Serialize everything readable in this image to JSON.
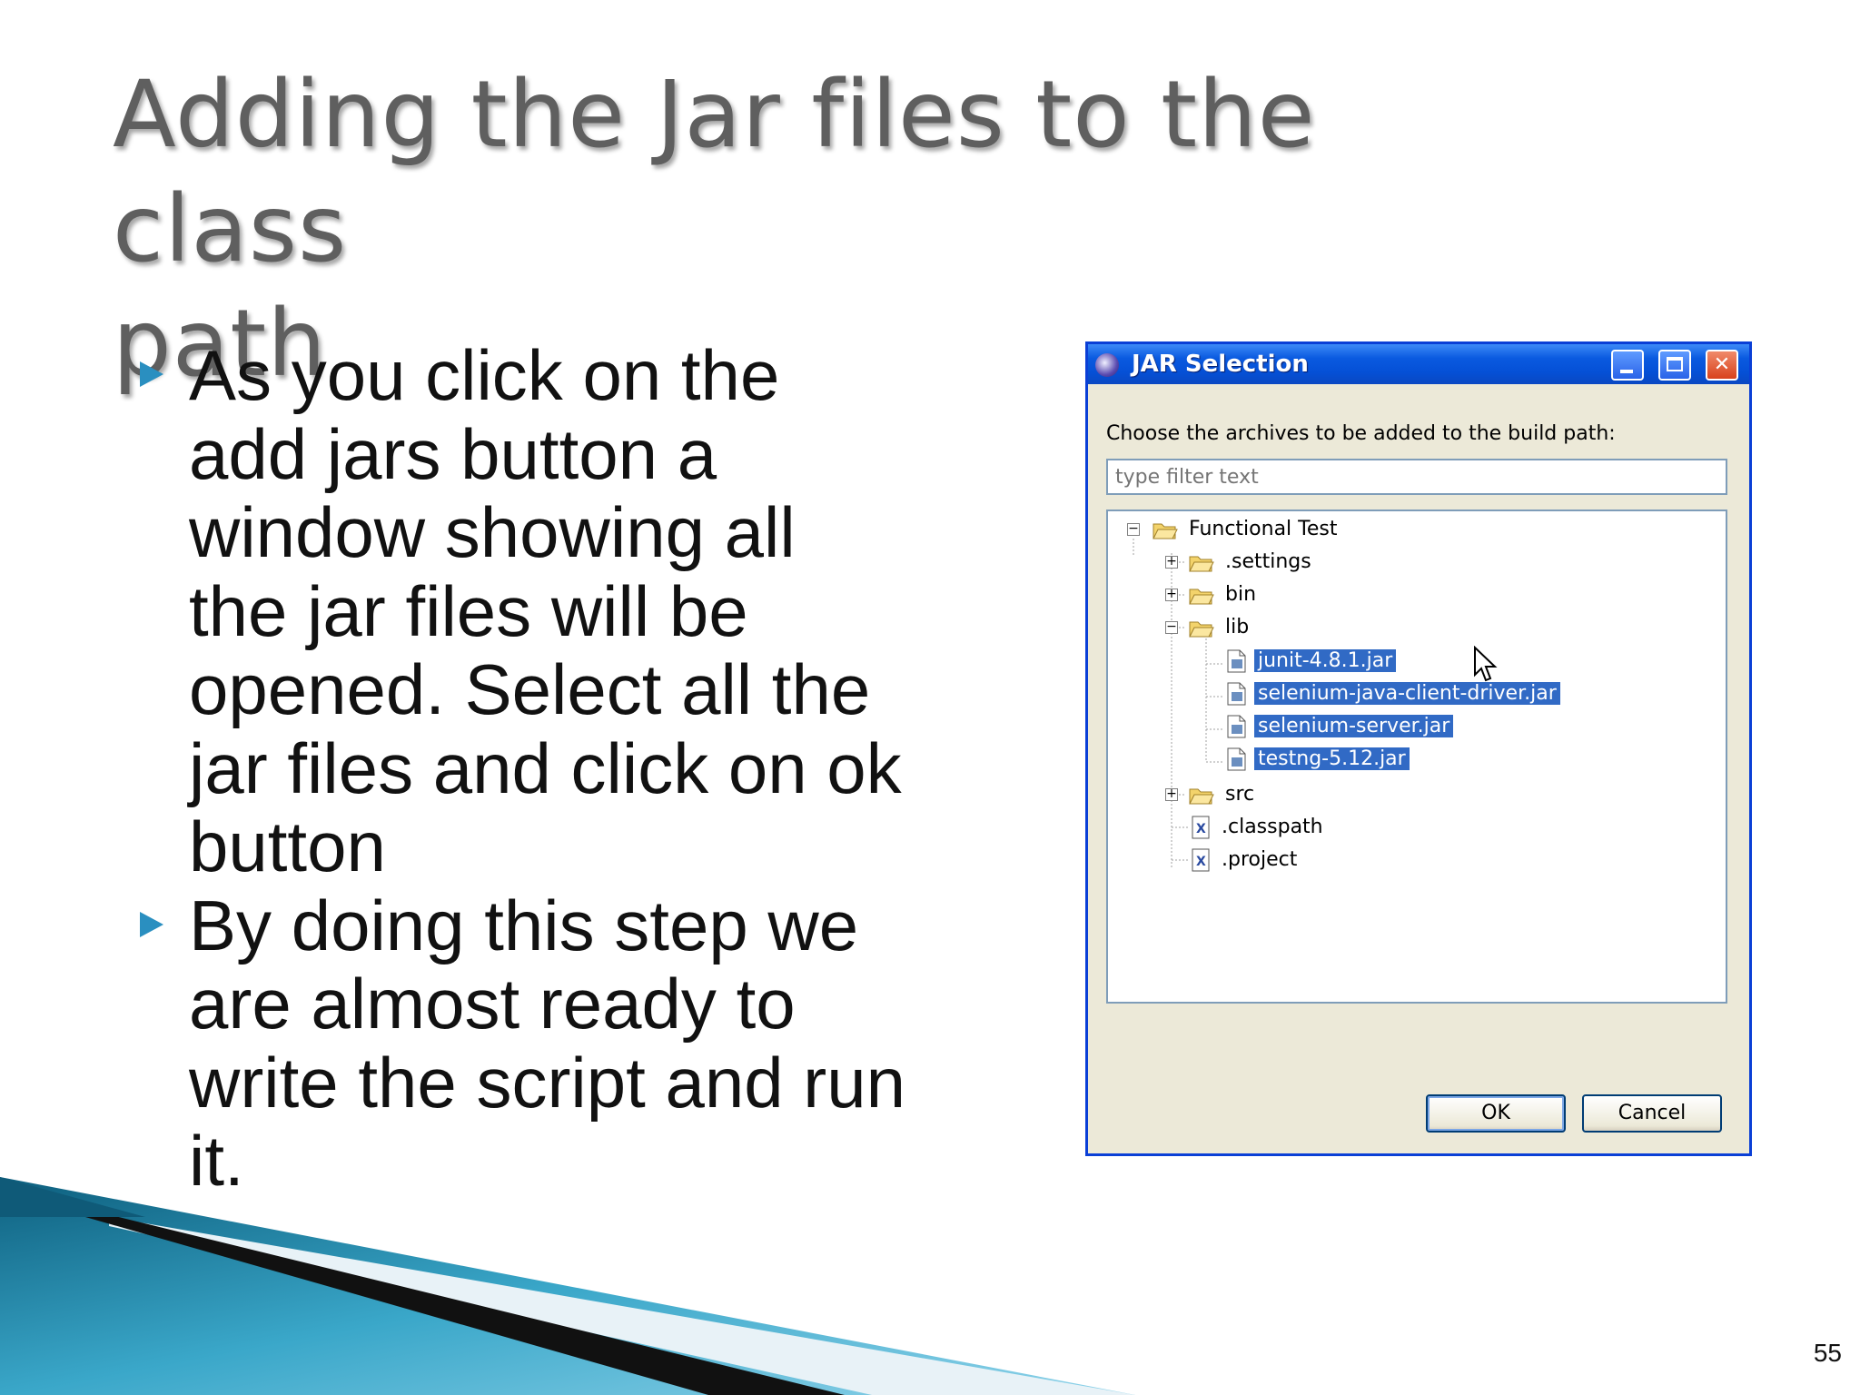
{
  "slide": {
    "title_line1": "Adding the Jar files to the class",
    "title_line2": "path",
    "bullets": [
      "As you click on the add jars button a window showing all the jar files will be opened. Select all the jar files and click on ok button",
      "By doing this step we are almost ready to write the script and run it."
    ],
    "page_number": "55"
  },
  "dialog": {
    "title": "JAR Selection",
    "prompt": "Choose the archives to be added to the build path:",
    "filter_placeholder": "type filter text",
    "tree": {
      "root": "Functional Test",
      "items": [
        {
          "label": ".settings",
          "kind": "folder",
          "expander": "+"
        },
        {
          "label": "bin",
          "kind": "folder",
          "expander": "+"
        },
        {
          "label": "lib",
          "kind": "folder",
          "expander": "−"
        },
        {
          "label": "junit-4.8.1.jar",
          "kind": "jar",
          "selected": true
        },
        {
          "label": "selenium-java-client-driver.jar",
          "kind": "jar",
          "selected": true
        },
        {
          "label": "selenium-server.jar",
          "kind": "jar",
          "selected": true
        },
        {
          "label": "testng-5.12.jar",
          "kind": "jar",
          "selected": true
        },
        {
          "label": "src",
          "kind": "folder",
          "expander": "+"
        },
        {
          "label": ".classpath",
          "kind": "xml-file"
        },
        {
          "label": ".project",
          "kind": "xml-file"
        }
      ]
    },
    "ok_label": "OK",
    "cancel_label": "Cancel",
    "selection_color": "#316ac5"
  },
  "icons": [
    "eclipse-icon",
    "folder-icon",
    "jar-file-icon",
    "xml-file-icon",
    "mouse-cursor-icon",
    "bullet-triangle-icon"
  ]
}
